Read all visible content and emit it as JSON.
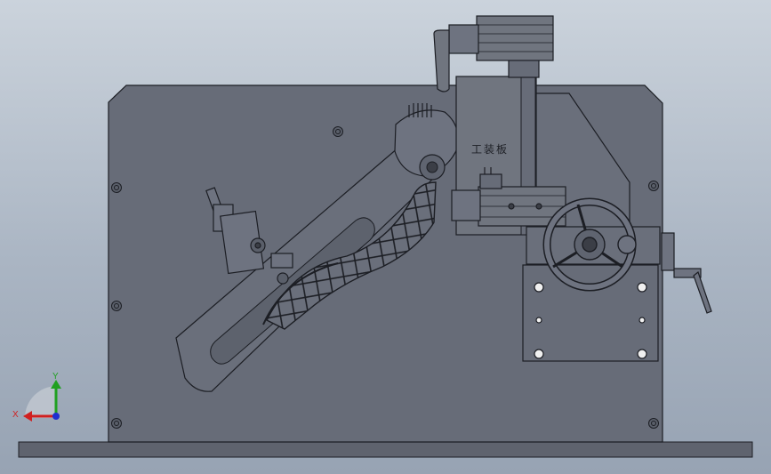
{
  "model": {
    "plate_label": "工装板"
  },
  "triad": {
    "x_label": "X",
    "y_label": "Y",
    "x_color": "#d02020",
    "y_color": "#20a020",
    "z_color": "#2030d0"
  },
  "colors": {
    "body": "#676c78",
    "edge": "#1c1e24",
    "base": "#5f636e"
  }
}
